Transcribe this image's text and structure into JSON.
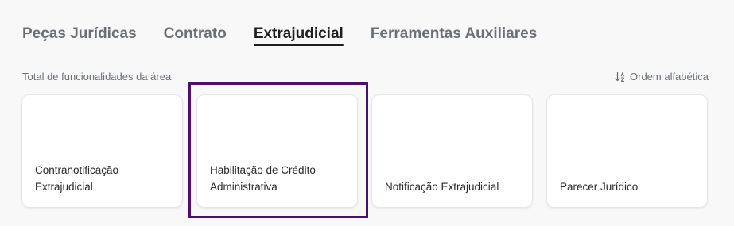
{
  "tabs": [
    {
      "label": "Peças Jurídicas",
      "active": false
    },
    {
      "label": "Contrato",
      "active": false
    },
    {
      "label": "Extrajudicial",
      "active": true
    },
    {
      "label": "Ferramentas Auxiliares",
      "active": false
    }
  ],
  "summary": {
    "label": "Total de funcionalidades da área"
  },
  "sort": {
    "label": "Ordem alfabética",
    "icon": "sort-alphabetical-icon"
  },
  "cards": [
    {
      "label": "Contranotificação Extrajudicial"
    },
    {
      "label": "Habilitação de Crédito Administrativa"
    },
    {
      "label": "Notificação Extrajudicial"
    },
    {
      "label": "Parecer Jurídico"
    }
  ],
  "colors": {
    "highlight": "#4b0f70",
    "active_tab": "#1f1f1f",
    "inactive_tab": "#6b6f76"
  }
}
